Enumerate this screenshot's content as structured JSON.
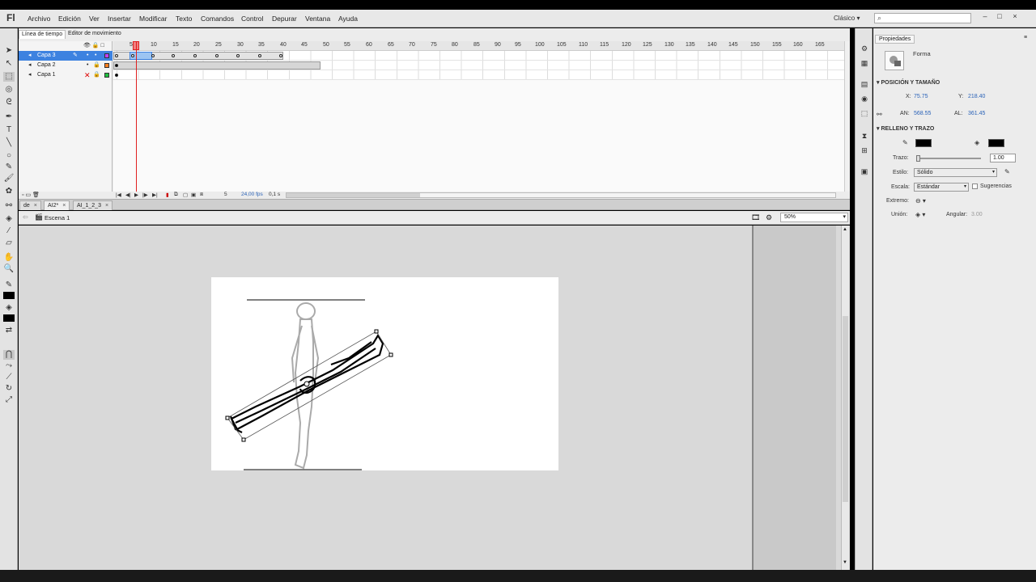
{
  "app": {
    "logo": "Fl",
    "workspace": "Clásico"
  },
  "menu": [
    "Archivo",
    "Edición",
    "Ver",
    "Insertar",
    "Modificar",
    "Texto",
    "Comandos",
    "Control",
    "Depurar",
    "Ventana",
    "Ayuda"
  ],
  "window_buttons": [
    "–",
    "□",
    "×"
  ],
  "timeline": {
    "tabs": [
      "Línea de tiempo",
      "Editor de movimiento"
    ],
    "layers": [
      {
        "name": "Capa 3",
        "color": "#c040ff",
        "selected": true
      },
      {
        "name": "Capa 2",
        "color": "#ff8020",
        "selected": false
      },
      {
        "name": "Capa 1",
        "color": "#20c040",
        "selected": false
      }
    ],
    "frame_labels": [
      "5",
      "10",
      "15",
      "20",
      "25",
      "30",
      "35",
      "40",
      "45",
      "50",
      "55",
      "60",
      "65",
      "70",
      "75",
      "80",
      "85",
      "90",
      "95",
      "100",
      "105",
      "110",
      "115",
      "120",
      "125",
      "130",
      "135",
      "140",
      "145",
      "150",
      "155",
      "160",
      "165"
    ],
    "current_frame": "5",
    "fps": "24,00 fps",
    "time": "0,1 s"
  },
  "doc_tabs": [
    {
      "label": "de",
      "active": false
    },
    {
      "label": "AI2*",
      "active": true
    },
    {
      "label": "AI_1_2_3",
      "active": false
    }
  ],
  "editbar": {
    "scene": "Escena 1",
    "zoom": "50%"
  },
  "properties": {
    "tab": "Propiedades",
    "object_type": "Forma",
    "pos_section": "POSICIÓN Y TAMAÑO",
    "x_label": "X:",
    "x_value": "75.75",
    "y_label": "Y:",
    "y_value": "218.40",
    "w_label": "AN:",
    "w_value": "568.55",
    "h_label": "AL:",
    "h_value": "361.45",
    "fill_section": "RELLENO Y TRAZO",
    "stroke_label": "Trazo:",
    "stroke_value": "1.00",
    "style_label": "Estilo:",
    "style_value": "Sólido",
    "scale_label": "Escala:",
    "scale_value": "Estándar",
    "hints_label": "Sugerencias",
    "cap_label": "Extremo:",
    "join_label": "Unión:",
    "miter_label": "Angular:",
    "miter_value": "3.00"
  }
}
